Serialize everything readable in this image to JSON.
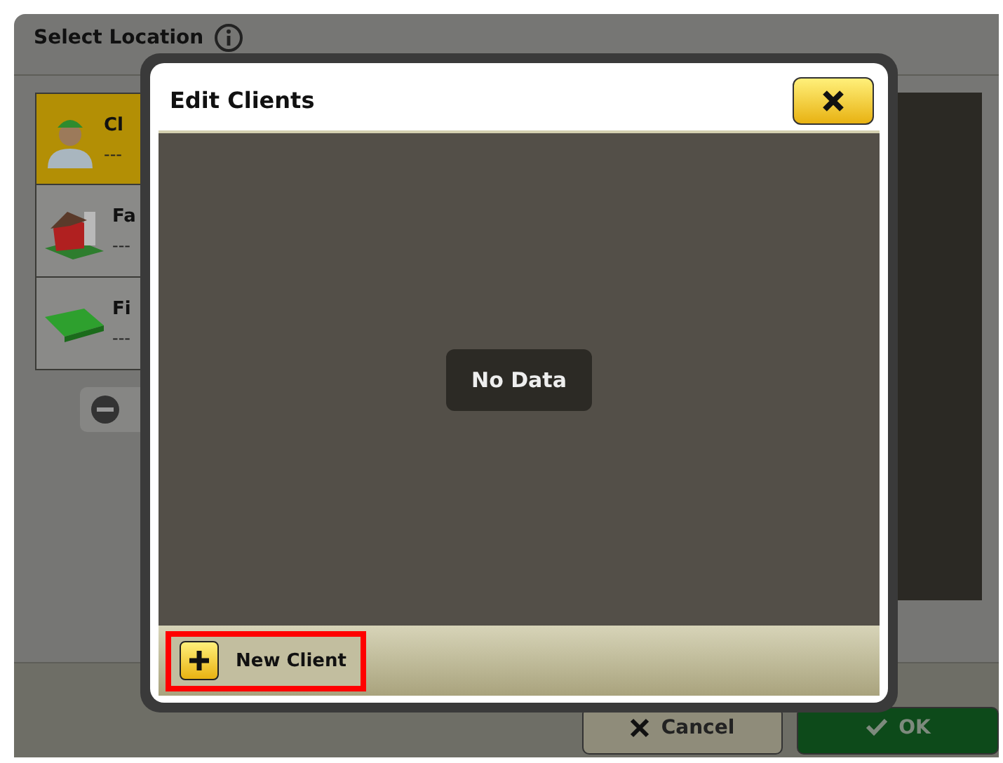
{
  "background_screen": {
    "title": "Select Location",
    "locations": [
      {
        "kind": "client",
        "name": "Cl",
        "value": "---",
        "selected": true
      },
      {
        "kind": "farm",
        "name": "Fa",
        "value": "---",
        "selected": false
      },
      {
        "kind": "field",
        "name": "Fi",
        "value": "---",
        "selected": false
      }
    ],
    "buttons": [
      {
        "kind": "cancel",
        "label": "Cancel"
      },
      {
        "kind": "ok",
        "label": "OK"
      }
    ]
  },
  "dialog": {
    "title": "Edit Clients",
    "empty_message": "No Data",
    "new_button": {
      "label": "New Client",
      "highlighted": true
    }
  }
}
